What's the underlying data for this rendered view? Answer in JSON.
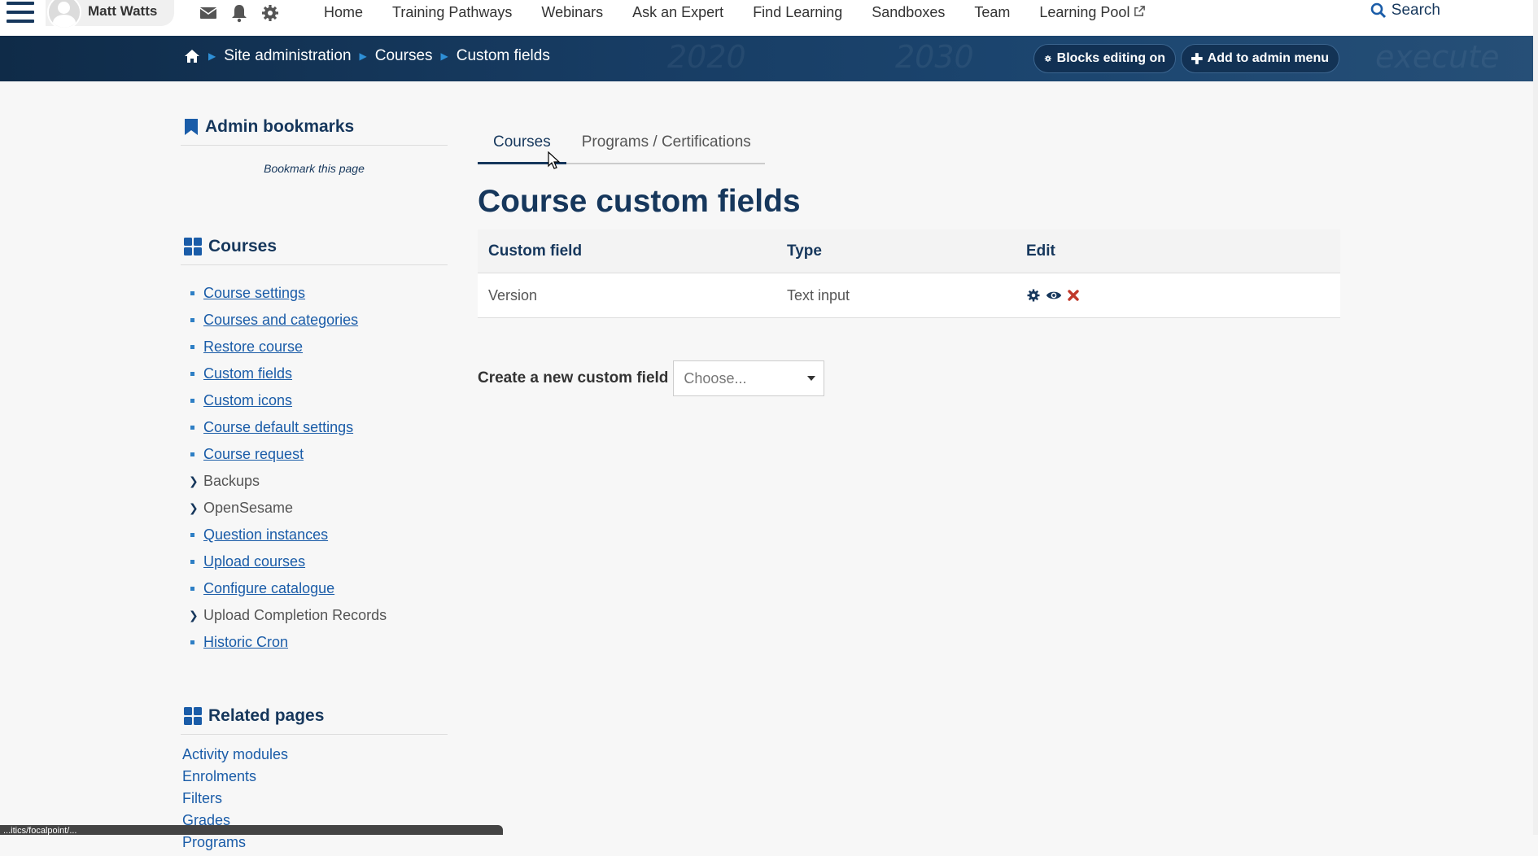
{
  "topnav": {
    "user_name": "Matt Watts",
    "links": [
      "Home",
      "Training Pathways",
      "Webinars",
      "Ask an Expert",
      "Find Learning",
      "Sandboxes",
      "Team",
      "Learning Pool"
    ],
    "search_label": "Search"
  },
  "banner": {
    "breadcrumb": [
      "Site administration",
      "Courses",
      "Custom fields"
    ],
    "blocks_editing_label": "Blocks editing on",
    "add_admin_menu_label": "Add to admin menu",
    "deco_texts": [
      "2020",
      "2030",
      "execute"
    ]
  },
  "sidebar": {
    "bookmarks_title": "Admin bookmarks",
    "bookmark_link": "Bookmark this page",
    "courses_title": "Courses",
    "courses_items": [
      {
        "label": "Course settings",
        "type": "link"
      },
      {
        "label": "Courses and categories",
        "type": "link"
      },
      {
        "label": "Restore course",
        "type": "link"
      },
      {
        "label": "Custom fields",
        "type": "link"
      },
      {
        "label": "Custom icons",
        "type": "link"
      },
      {
        "label": "Course default settings",
        "type": "link"
      },
      {
        "label": "Course request",
        "type": "link"
      },
      {
        "label": "Backups",
        "type": "expand"
      },
      {
        "label": "OpenSesame",
        "type": "expand"
      },
      {
        "label": "Question instances",
        "type": "link"
      },
      {
        "label": "Upload courses",
        "type": "link"
      },
      {
        "label": "Configure catalogue",
        "type": "link"
      },
      {
        "label": "Upload Completion Records",
        "type": "expand"
      },
      {
        "label": "Historic Cron",
        "type": "link"
      }
    ],
    "related_title": "Related pages",
    "related_items": [
      "Activity modules",
      "Enrolments",
      "Filters",
      "Grades",
      "Programs"
    ]
  },
  "main": {
    "tabs": [
      "Courses",
      "Programs / Certifications"
    ],
    "active_tab": 0,
    "title": "Course custom fields",
    "table": {
      "headers": [
        "Custom field",
        "Type",
        "Edit"
      ],
      "rows": [
        {
          "field": "Version",
          "type": "Text input"
        }
      ]
    },
    "create_label": "Create a new custom field",
    "create_select_value": "Choose..."
  },
  "statusbar_text": "...itics/focalpoint/..."
}
